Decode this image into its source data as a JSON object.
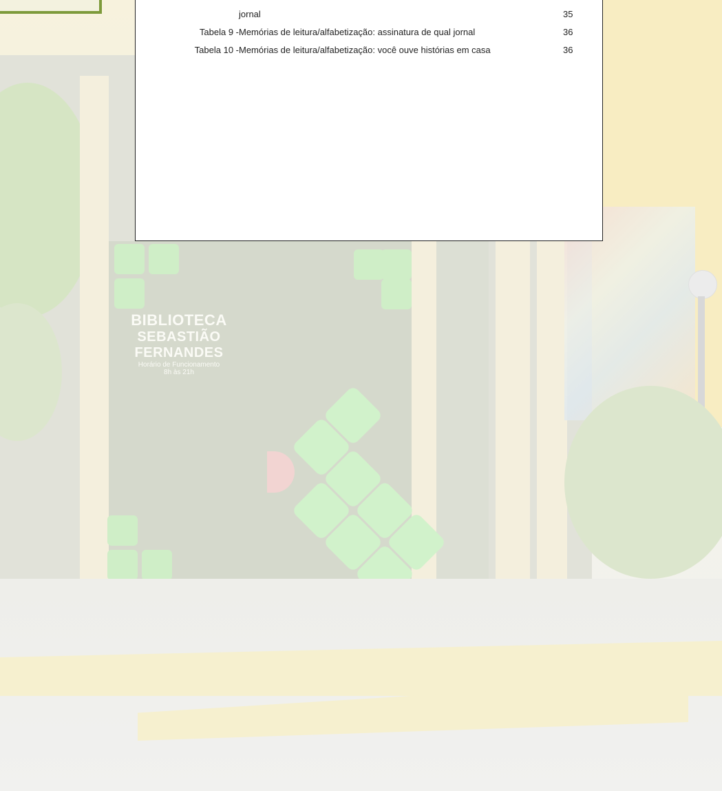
{
  "background_photo": {
    "sign_line_1": "BIBLIOTECA",
    "sign_line_2": "SEBASTIÃO FERNANDES",
    "sign_line_3": "Horário de Funcionamento",
    "sign_line_4": "8h às 21h"
  },
  "toc": {
    "rows": [
      {
        "label": "",
        "title": "jornal",
        "page": "35"
      },
      {
        "label": "Tabela 9  -",
        "title": "Memórias de leitura/alfabetização: assinatura de qual jornal",
        "page": "36"
      },
      {
        "label": "Tabela 10 -",
        "title": "Memórias de leitura/alfabetização: você ouve histórias em casa",
        "page": "36"
      }
    ]
  },
  "colors": {
    "frame_green": "#7d9a3a",
    "panel_border": "#222222",
    "tile_green": "#cfeec7"
  }
}
